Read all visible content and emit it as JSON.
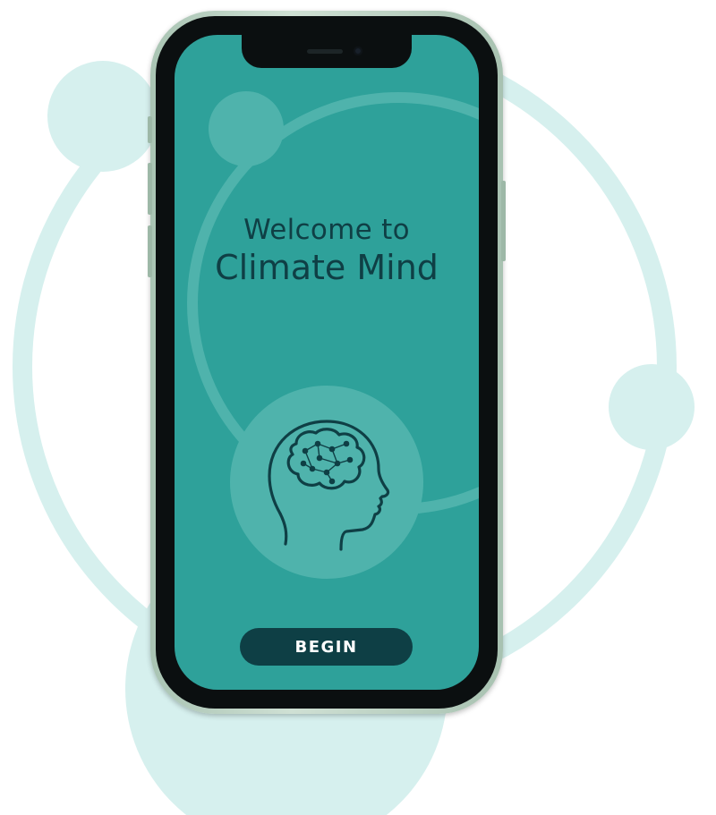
{
  "screen": {
    "welcome_line1": "Welcome to",
    "welcome_line2": "Climate Mind",
    "begin_label": "BEGIN",
    "brain_icon": "head-with-brain-icon"
  },
  "colors": {
    "screen_bg": "#2ea19a",
    "text_dark": "#0f3f45",
    "button_bg": "#0e3f45",
    "button_text": "#ffffff",
    "decoration_light": "#d6f0ee",
    "phone_frame": "#b7cfbf"
  }
}
